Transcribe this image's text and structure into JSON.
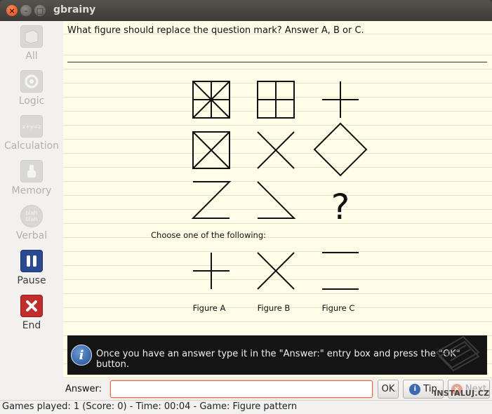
{
  "window": {
    "title": "gbrainy"
  },
  "sidebar": {
    "items": [
      {
        "label": "All",
        "enabled": false,
        "icon": "all-games-icon"
      },
      {
        "label": "Logic",
        "enabled": false,
        "icon": "logic-icon"
      },
      {
        "label": "Calculation",
        "enabled": false,
        "icon": "calculation-icon",
        "glyph": "x+y=z"
      },
      {
        "label": "Memory",
        "enabled": false,
        "icon": "memory-icon"
      },
      {
        "label": "Verbal",
        "enabled": false,
        "icon": "verbal-icon",
        "glyph": "blah blah"
      },
      {
        "label": "Pause",
        "enabled": true,
        "icon": "pause-icon"
      },
      {
        "label": "End",
        "enabled": true,
        "icon": "end-icon"
      }
    ]
  },
  "puzzle": {
    "question": "What figure should replace the question mark? Answer A, B or C.",
    "mystery": "?",
    "choose_text": "Choose one of the following:",
    "options": [
      {
        "label": "Figure A"
      },
      {
        "label": "Figure B"
      },
      {
        "label": "Figure C"
      }
    ]
  },
  "info": {
    "glyph": "i",
    "message": "Once you have an answer type it in the \"Answer:\" entry box and press the \"OK\" button."
  },
  "answer": {
    "label": "Answer:",
    "value": "",
    "ok_label": "OK",
    "tip_label": "Tip",
    "next_label": "Next"
  },
  "status": {
    "text": "Games played: 1 (Score: 0) - Time: 00:04 - Game: Figure pattern"
  },
  "watermark": {
    "text": "INSTALUJ.CZ"
  },
  "colors": {
    "pause": "#2a4a8f",
    "end": "#c12c2c",
    "paper": "#fffde8"
  }
}
